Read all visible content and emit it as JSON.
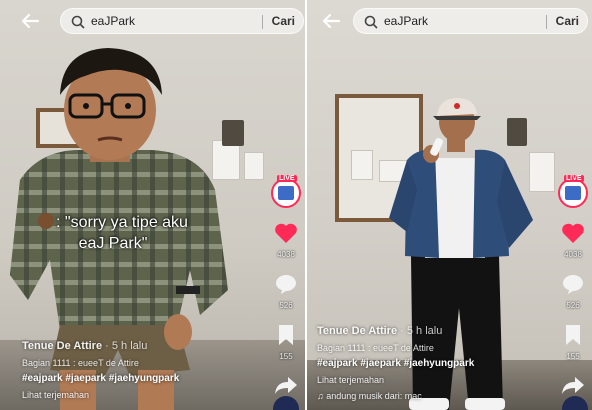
{
  "left": {
    "search": {
      "query": "eaJPark",
      "button": "Cari"
    },
    "caption": {
      "line1": ": \"sorry ya tipe aku",
      "line2": "eaJ Park\""
    },
    "rail": {
      "like_count": "4038",
      "comment_count": "526",
      "save_count": "155",
      "share_count": "163"
    },
    "info": {
      "author": "Tenue De Attire",
      "time": " · 5 h lalu",
      "part": "Bagian 1111 : eueeT de Attire",
      "tags": "#eajpark #jaepark #jaehyungpark",
      "translate": "Lihat terjemahan"
    }
  },
  "right": {
    "search": {
      "query": "eaJPark",
      "button": "Cari"
    },
    "rail": {
      "like_count": "4038",
      "comment_count": "526",
      "save_count": "155",
      "share_count": "163"
    },
    "info": {
      "author": "Tenue De Attire",
      "time": " · 5 h lalu",
      "part": "Bagian 1111 : eueeT de Attire",
      "tags": "#eajpark #jaepark #jaehyungpark",
      "translate": "Lihat terjemahan",
      "music": "♫ andung musik dari: mac"
    }
  },
  "colors": {
    "like": "#ff2a55",
    "live_ring": "#ff2a55"
  }
}
